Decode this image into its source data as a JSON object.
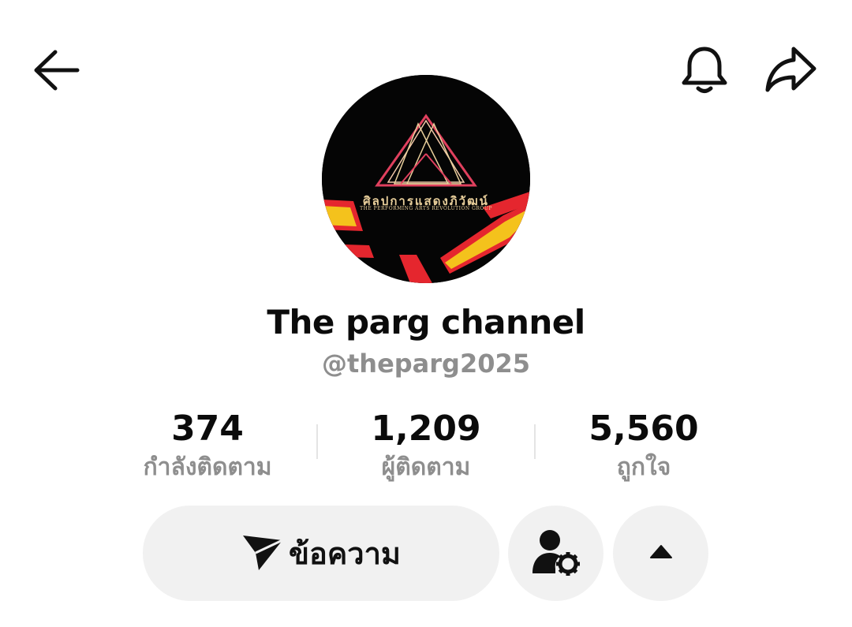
{
  "header": {
    "back_icon": "arrow-left-icon",
    "bell_icon": "bell-icon",
    "share_icon": "share-arrow-icon"
  },
  "avatar": {
    "logo_thai": "ศิลปการแสดงภิวัฒน์",
    "logo_english": "THE PERFORMING ARTS REVOLUTION GROUP",
    "colors": {
      "background": "#050505",
      "red": "#e5262e",
      "yellow": "#f4c21c",
      "pink": "#e0405e",
      "gold": "#e9cf9b"
    }
  },
  "profile": {
    "display_name": "The parg channel",
    "username": "@theparg2025"
  },
  "stats": {
    "following": {
      "value": "374",
      "label": "กำลังติดตาม"
    },
    "followers": {
      "value": "1,209",
      "label": "ผู้ติดตาม"
    },
    "likes": {
      "value": "5,560",
      "label": "ถูกใจ"
    }
  },
  "actions": {
    "message_label": "ข้อความ",
    "message_icon": "send-icon",
    "friends_icon": "user-settings-icon",
    "more_icon": "caret-up-icon"
  },
  "colors": {
    "text_primary": "#0b0b0b",
    "text_secondary": "#8e8e8e",
    "button_bg": "#f1f1f1"
  }
}
